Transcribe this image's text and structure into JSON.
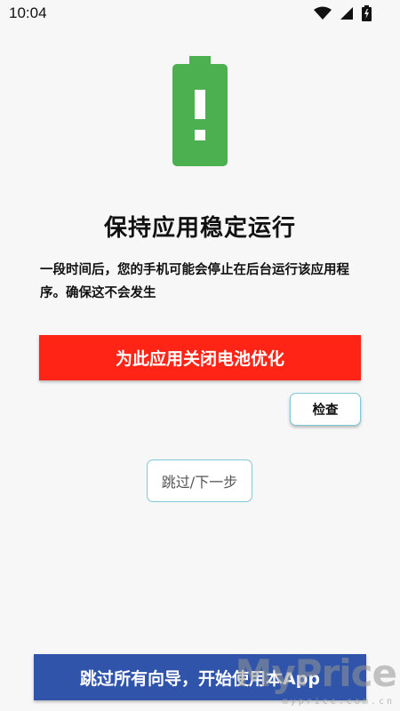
{
  "status_bar": {
    "time": "10:04",
    "icons": [
      "wifi-icon",
      "signal-icon",
      "battery-charging-icon"
    ]
  },
  "hero": {
    "icon": "battery-alert-icon",
    "icon_color": "#4caf50"
  },
  "title": "保持应用稳定运行",
  "description": "一段时间后，您的手机可能会停止在后台运行该应用程序。确保这不会发生",
  "buttons": {
    "disable_optimization": "为此应用关闭电池优化",
    "check": "检查",
    "skip_next": "跳过/下一步",
    "skip_all": "跳过所有向导，开始使用本App"
  },
  "colors": {
    "primary_red": "#ff2415",
    "primary_blue": "#2f54aa",
    "outline": "#7fc8d6"
  },
  "watermark": {
    "logo": "MyPrice",
    "url": "myprice.com.cn"
  }
}
